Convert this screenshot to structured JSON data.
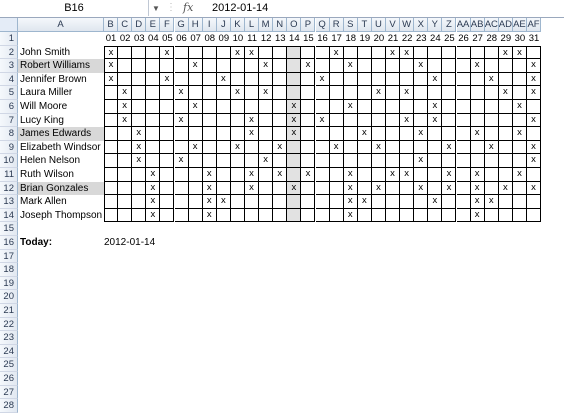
{
  "name_box": "B16",
  "fx_symbol": "fx",
  "formula_value": "2012-01-14",
  "column_headers": [
    "A",
    "B",
    "C",
    "D",
    "E",
    "F",
    "G",
    "H",
    "I",
    "J",
    "K",
    "L",
    "M",
    "N",
    "O",
    "P",
    "Q",
    "R",
    "S",
    "T",
    "U",
    "V",
    "W",
    "X",
    "Y",
    "Z",
    "AA",
    "AB",
    "AC",
    "AD",
    "AE",
    "AF"
  ],
  "row_numbers": [
    "1",
    "2",
    "3",
    "4",
    "5",
    "6",
    "7",
    "8",
    "9",
    "10",
    "11",
    "12",
    "13",
    "14",
    "15",
    "16",
    "17",
    "18",
    "19",
    "20",
    "21",
    "22",
    "23",
    "24",
    "25",
    "26",
    "27",
    "28"
  ],
  "days": [
    "01",
    "02",
    "03",
    "04",
    "05",
    "06",
    "07",
    "08",
    "09",
    "10",
    "11",
    "12",
    "13",
    "14",
    "15",
    "16",
    "17",
    "18",
    "19",
    "20",
    "21",
    "22",
    "23",
    "24",
    "25",
    "26",
    "27",
    "28",
    "29",
    "30",
    "31"
  ],
  "highlight_day_index": 13,
  "mark_char": "x",
  "colors": {
    "header_bg": "#e4ecf7",
    "name_highlight": "#d8d8d8",
    "today_column": "#e2e2e2"
  },
  "rows": [
    {
      "name": "John Smith",
      "highlight": false,
      "marks": [
        1,
        0,
        0,
        0,
        1,
        0,
        0,
        0,
        0,
        1,
        1,
        0,
        0,
        0,
        0,
        0,
        1,
        0,
        0,
        0,
        1,
        1,
        0,
        0,
        0,
        0,
        0,
        0,
        1,
        1,
        0
      ]
    },
    {
      "name": "Robert Williams",
      "highlight": true,
      "marks": [
        1,
        0,
        0,
        0,
        0,
        0,
        1,
        0,
        0,
        0,
        0,
        1,
        0,
        0,
        1,
        0,
        0,
        1,
        0,
        0,
        0,
        0,
        1,
        0,
        0,
        0,
        1,
        0,
        0,
        0,
        1
      ]
    },
    {
      "name": "Jennifer Brown",
      "highlight": false,
      "marks": [
        1,
        0,
        0,
        0,
        1,
        0,
        0,
        0,
        1,
        0,
        0,
        0,
        0,
        0,
        0,
        1,
        0,
        0,
        0,
        0,
        0,
        0,
        0,
        1,
        0,
        0,
        0,
        1,
        0,
        0,
        1
      ]
    },
    {
      "name": "Laura Miller",
      "highlight": false,
      "marks": [
        0,
        1,
        0,
        0,
        0,
        1,
        0,
        0,
        0,
        1,
        0,
        1,
        0,
        0,
        0,
        0,
        0,
        0,
        0,
        1,
        0,
        1,
        0,
        0,
        0,
        0,
        0,
        0,
        1,
        0,
        1
      ]
    },
    {
      "name": "Will Moore",
      "highlight": false,
      "marks": [
        0,
        1,
        0,
        0,
        0,
        0,
        1,
        0,
        0,
        0,
        0,
        0,
        0,
        1,
        0,
        0,
        0,
        1,
        0,
        0,
        0,
        0,
        0,
        1,
        0,
        0,
        0,
        0,
        0,
        1,
        0
      ]
    },
    {
      "name": "Lucy King",
      "highlight": false,
      "marks": [
        0,
        1,
        0,
        0,
        0,
        1,
        0,
        0,
        0,
        0,
        1,
        0,
        0,
        1,
        0,
        1,
        0,
        0,
        0,
        0,
        0,
        1,
        0,
        1,
        0,
        0,
        0,
        0,
        0,
        0,
        1
      ]
    },
    {
      "name": "James Edwards",
      "highlight": true,
      "marks": [
        0,
        0,
        1,
        0,
        0,
        0,
        0,
        0,
        0,
        0,
        1,
        0,
        0,
        1,
        0,
        0,
        0,
        0,
        1,
        0,
        0,
        0,
        1,
        0,
        0,
        0,
        1,
        0,
        0,
        1,
        0
      ]
    },
    {
      "name": "Elizabeth Windsor",
      "highlight": false,
      "marks": [
        0,
        0,
        1,
        0,
        0,
        0,
        1,
        0,
        0,
        1,
        0,
        0,
        1,
        0,
        0,
        0,
        1,
        0,
        0,
        1,
        0,
        0,
        0,
        0,
        1,
        0,
        0,
        1,
        0,
        0,
        1
      ]
    },
    {
      "name": "Helen Nelson",
      "highlight": false,
      "marks": [
        0,
        0,
        1,
        0,
        0,
        1,
        0,
        0,
        0,
        0,
        0,
        1,
        0,
        0,
        0,
        0,
        0,
        0,
        0,
        0,
        0,
        0,
        1,
        0,
        0,
        0,
        0,
        0,
        0,
        0,
        1
      ]
    },
    {
      "name": "Ruth Wilson",
      "highlight": false,
      "marks": [
        0,
        0,
        0,
        1,
        0,
        0,
        0,
        1,
        0,
        0,
        1,
        0,
        1,
        0,
        1,
        0,
        0,
        1,
        0,
        0,
        1,
        1,
        0,
        0,
        1,
        0,
        1,
        0,
        0,
        1,
        0
      ]
    },
    {
      "name": "Brian Gonzales",
      "highlight": true,
      "marks": [
        0,
        0,
        0,
        1,
        0,
        0,
        0,
        1,
        0,
        0,
        1,
        0,
        0,
        1,
        0,
        0,
        0,
        1,
        0,
        1,
        0,
        0,
        1,
        0,
        1,
        0,
        1,
        0,
        1,
        0,
        1
      ]
    },
    {
      "name": "Mark Allen",
      "highlight": false,
      "marks": [
        0,
        0,
        0,
        1,
        0,
        0,
        0,
        1,
        1,
        0,
        0,
        0,
        0,
        0,
        0,
        0,
        0,
        1,
        1,
        0,
        0,
        0,
        0,
        1,
        0,
        0,
        1,
        1,
        0,
        0,
        0
      ]
    },
    {
      "name": "Joseph Thompson",
      "highlight": false,
      "marks": [
        0,
        0,
        0,
        1,
        0,
        0,
        0,
        1,
        0,
        0,
        0,
        0,
        0,
        0,
        0,
        0,
        0,
        1,
        0,
        0,
        0,
        0,
        0,
        0,
        0,
        0,
        1,
        0,
        0,
        0,
        0
      ]
    }
  ],
  "today_label": "Today:",
  "today_value": "2012-01-14"
}
